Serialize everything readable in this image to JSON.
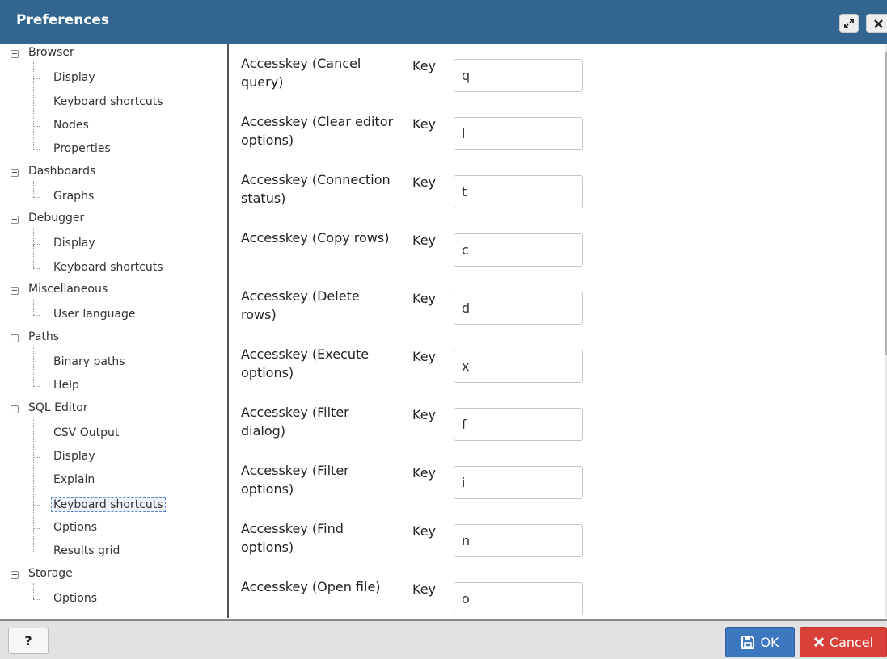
{
  "dialog": {
    "title": "Preferences",
    "maximize_icon": "expand-icon",
    "close_icon": "close-icon"
  },
  "tree": [
    {
      "label": "Browser",
      "children": [
        "Display",
        "Keyboard shortcuts",
        "Nodes",
        "Properties"
      ]
    },
    {
      "label": "Dashboards",
      "children": [
        "Graphs"
      ]
    },
    {
      "label": "Debugger",
      "children": [
        "Display",
        "Keyboard shortcuts"
      ]
    },
    {
      "label": "Miscellaneous",
      "children": [
        "User language"
      ]
    },
    {
      "label": "Paths",
      "children": [
        "Binary paths",
        "Help"
      ]
    },
    {
      "label": "SQL Editor",
      "children": [
        "CSV Output",
        "Display",
        "Explain",
        "Keyboard shortcuts",
        "Options",
        "Results grid"
      ]
    },
    {
      "label": "Storage",
      "children": [
        "Options"
      ]
    }
  ],
  "selected": {
    "group": 5,
    "child": 3
  },
  "shortcuts": [
    {
      "label": "Accesskey (Cancel query)",
      "key_label": "Key",
      "value": "q"
    },
    {
      "label": "Accesskey (Clear editor options)",
      "key_label": "Key",
      "value": "l"
    },
    {
      "label": "Accesskey (Connection status)",
      "key_label": "Key",
      "value": "t"
    },
    {
      "label": "Accesskey (Copy rows)",
      "key_label": "Key",
      "value": "c"
    },
    {
      "label": "Accesskey (Delete rows)",
      "key_label": "Key",
      "value": "d"
    },
    {
      "label": "Accesskey (Execute options)",
      "key_label": "Key",
      "value": "x"
    },
    {
      "label": "Accesskey (Filter dialog)",
      "key_label": "Key",
      "value": "f"
    },
    {
      "label": "Accesskey (Filter options)",
      "key_label": "Key",
      "value": "i"
    },
    {
      "label": "Accesskey (Find options)",
      "key_label": "Key",
      "value": "n"
    },
    {
      "label": "Accesskey (Open file)",
      "key_label": "Key",
      "value": "o"
    }
  ],
  "footer": {
    "help_label": "?",
    "ok_label": "OK",
    "cancel_label": "Cancel"
  },
  "colors": {
    "title_bar": "#326690",
    "ok": "#3c78c0",
    "cancel": "#d9403a"
  }
}
